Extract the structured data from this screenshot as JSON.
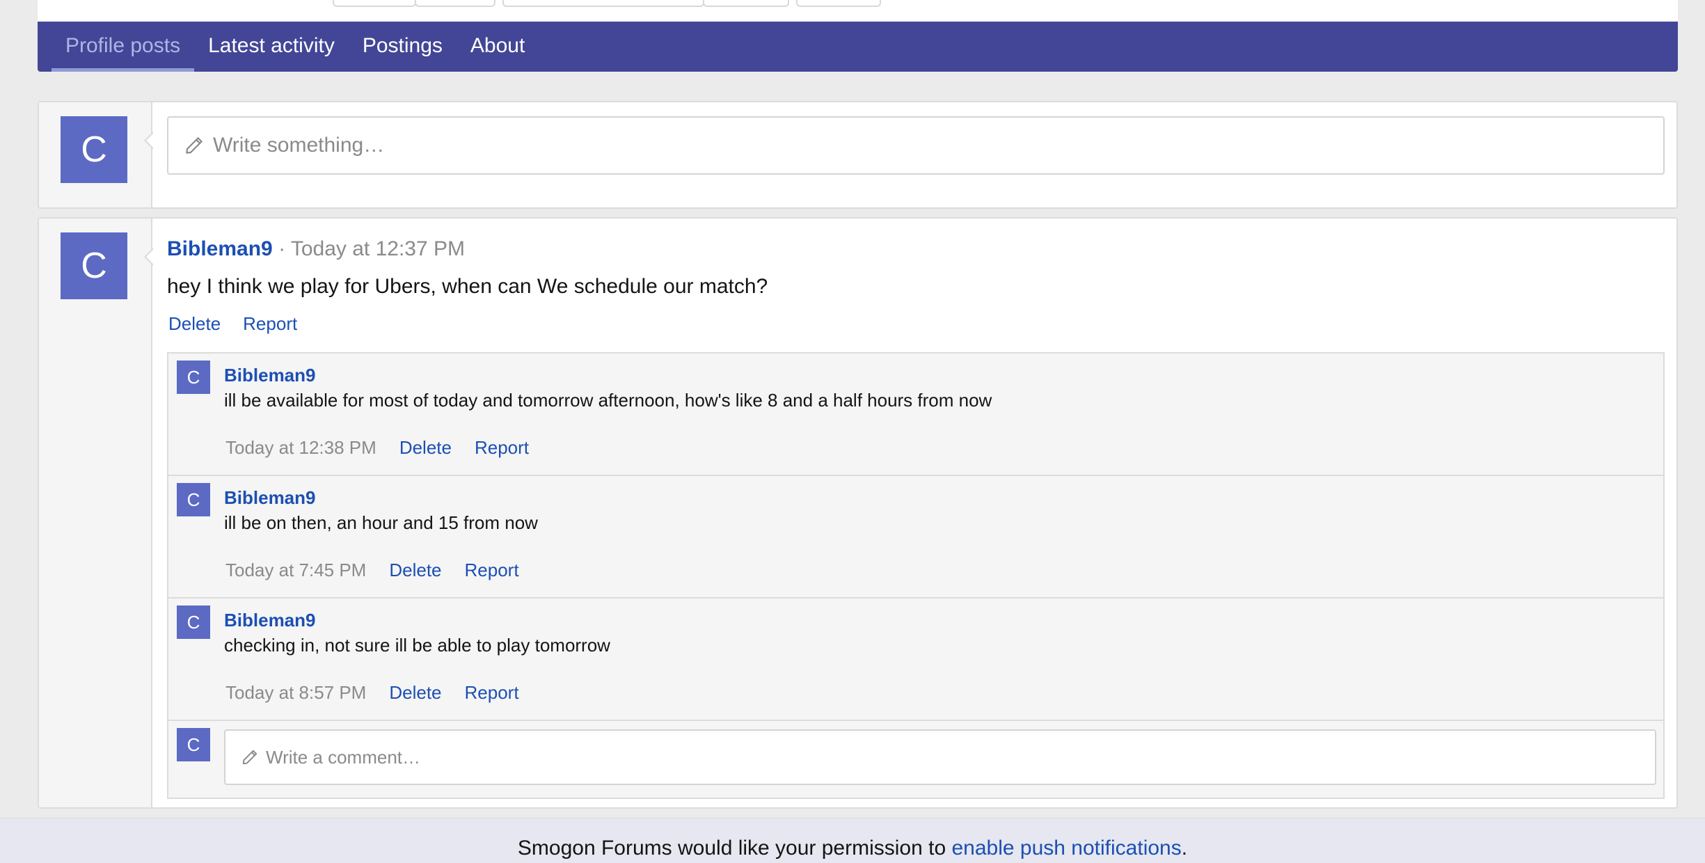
{
  "tabs": [
    {
      "label": "Profile posts",
      "active": true
    },
    {
      "label": "Latest activity",
      "active": false
    },
    {
      "label": "Postings",
      "active": false
    },
    {
      "label": "About",
      "active": false
    }
  ],
  "composer": {
    "avatar_letter": "C",
    "placeholder": "Write something…",
    "icon": "pencil-icon"
  },
  "post": {
    "avatar_letter": "C",
    "author": "Bibleman9",
    "separator": "·",
    "time": "Today at 12:37 PM",
    "body": "hey I think we play for Ubers, when can We schedule our match?",
    "actions": {
      "delete": "Delete",
      "report": "Report"
    }
  },
  "comments": [
    {
      "avatar_letter": "C",
      "author": "Bibleman9",
      "text": "ill be available for most of today and tomorrow afternoon, how's like 8 and a half hours from now",
      "time": "Today at 12:38 PM",
      "delete": "Delete",
      "report": "Report"
    },
    {
      "avatar_letter": "C",
      "author": "Bibleman9",
      "text": "ill be on then, an hour and 15 from now",
      "time": "Today at 7:45 PM",
      "delete": "Delete",
      "report": "Report"
    },
    {
      "avatar_letter": "C",
      "author": "Bibleman9",
      "text": "checking in, not sure ill be able to play tomorrow",
      "time": "Today at 8:57 PM",
      "delete": "Delete",
      "report": "Report"
    }
  ],
  "comment_input": {
    "avatar_letter": "C",
    "placeholder": "Write a comment…"
  },
  "notice": {
    "text_before": "Smogon Forums would like your permission to ",
    "link": "enable push notifications",
    "text_after": "."
  },
  "colors": {
    "tabbar": "#434696",
    "link": "#1c4fb3",
    "avatar": "#5c6ac4"
  }
}
